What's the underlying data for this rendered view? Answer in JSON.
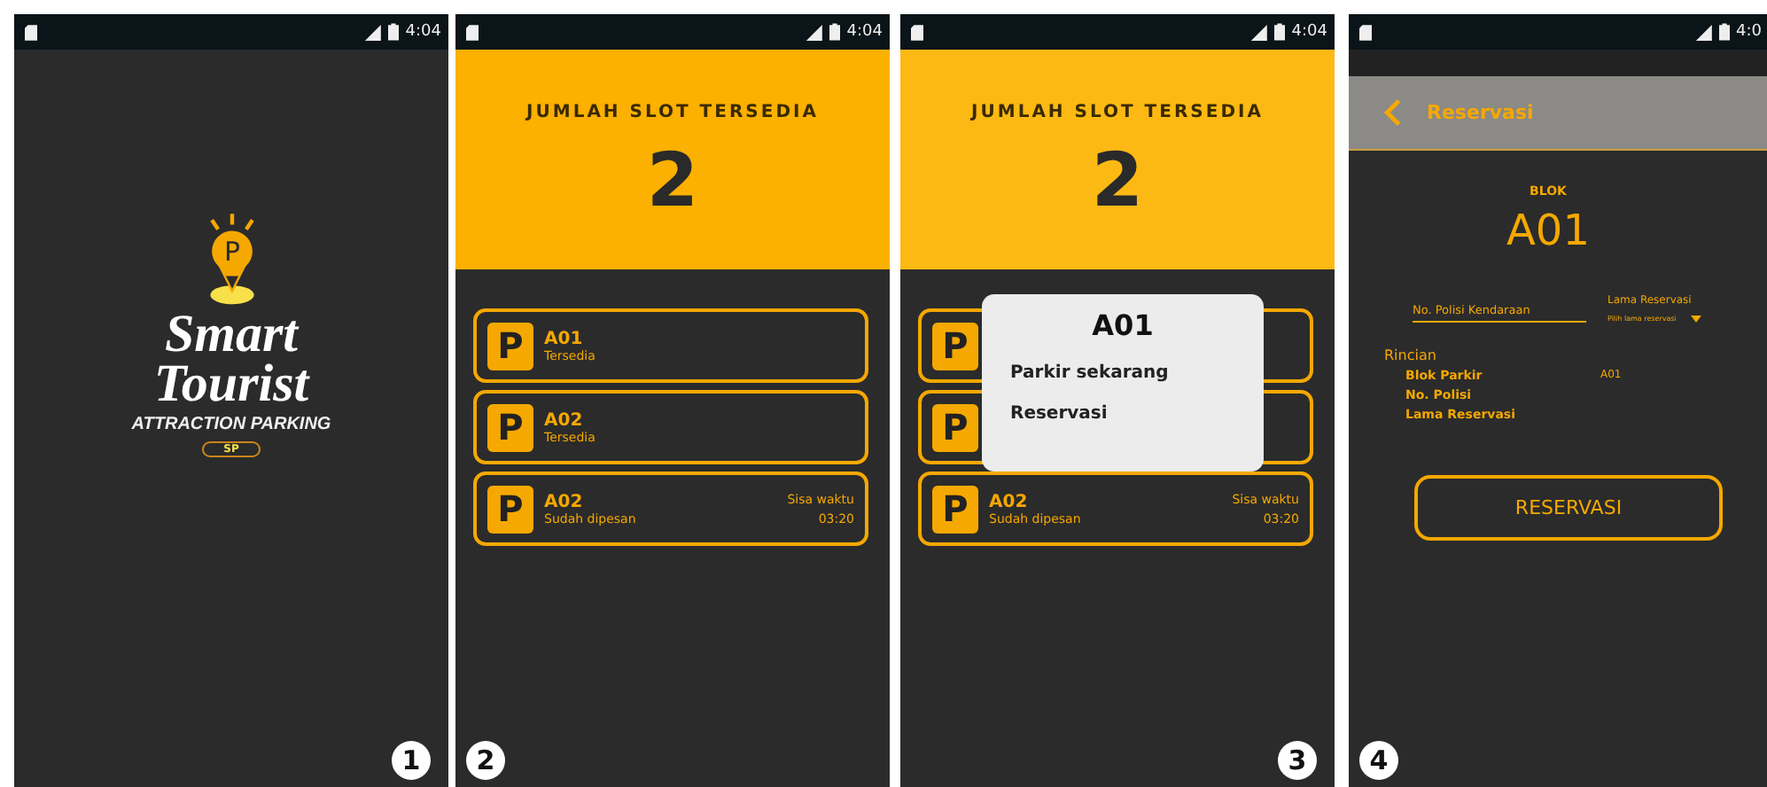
{
  "panels": [
    {
      "kind": "splash",
      "status_time": "4:04",
      "logo": {
        "pin_letter": "P",
        "line1": "Smart",
        "line2": "Tourist",
        "tagline": "ATTRACTION PARKING",
        "badge": "SP"
      },
      "step": "1"
    },
    {
      "kind": "slots",
      "status_time": "4:04",
      "header": {
        "title": "JUMLAH SLOT TERSEDIA",
        "count": "2"
      },
      "slots": [
        {
          "icon": "P",
          "code": "A01",
          "status": "Tersedia"
        },
        {
          "icon": "P",
          "code": "A02",
          "status": "Tersedia"
        },
        {
          "icon": "P",
          "code": "A02",
          "status": "Sudah dipesan",
          "timer_label": "Sisa waktu",
          "timer": "03:20"
        }
      ],
      "step": "2"
    },
    {
      "kind": "slots",
      "status_time": "4:04",
      "header": {
        "title": "JUMLAH SLOT TERSEDIA",
        "count": "2"
      },
      "slots": [
        {
          "icon": "P"
        },
        {
          "icon": "P"
        },
        {
          "icon": "P",
          "code": "A02",
          "status": "Sudah dipesan",
          "timer_label": "Sisa waktu",
          "timer": "03:20"
        }
      ],
      "dialog": {
        "title": "A01",
        "options": [
          "Parkir sekarang",
          "Reservasi"
        ]
      },
      "step": "3"
    },
    {
      "kind": "form",
      "status_time": "4:0",
      "app_bar": {
        "title": "Reservasi"
      },
      "block_label": "BLOK",
      "block": "A01",
      "plate_field": {
        "placeholder": "No. Polisi Kendaraan"
      },
      "duration": {
        "label": "Lama Reservasi",
        "placeholder": "Pilih lama reservasi"
      },
      "details": {
        "title": "Rincian",
        "rows": [
          {
            "label": "Blok Parkir",
            "value": "A01"
          },
          {
            "label": "No. Polisi"
          },
          {
            "label": "Lama Reservasi"
          }
        ]
      },
      "submit": "RESERVASI",
      "step": "4"
    }
  ]
}
